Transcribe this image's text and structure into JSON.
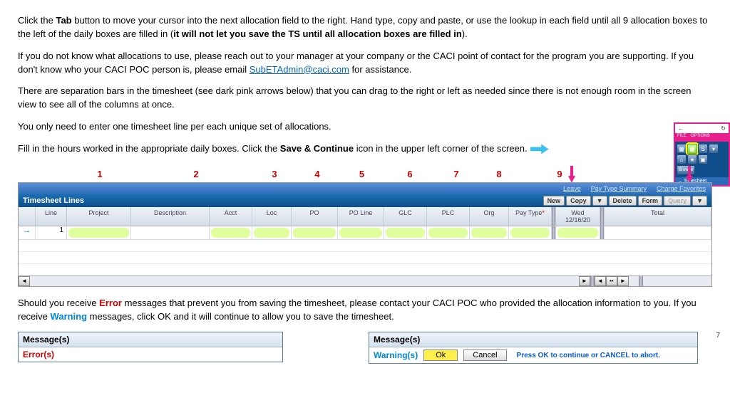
{
  "para1a": "Click the ",
  "para1b": "Tab",
  "para1c": " button to move your cursor into the next allocation field to the right.  Hand type, copy and paste, or use the lookup in each field until all 9 allocation boxes to the left of the daily boxes are filled in (",
  "para1d": "it will not let you save the TS until all allocation boxes are filled in",
  "para1e": ").",
  "para2a": "If you do not know what allocations to use, please reach out to your manager at your company or the CACI point of contact for the program you are supporting.  If you don't know who your CACI POC person is, please email ",
  "para2link": "SubETAdmin@caci.com",
  "para2b": " for assistance.",
  "para3": "There are separation bars in the timesheet (see dark pink arrows below) that you can drag to the right or left as needed since there is not enough room in the screen view to see all of the columns at once.",
  "para4": "You only need to enter one timesheet line per each unique set of allocations.",
  "para5a": "Fill in the hours worked in the appropriate daily boxes. Click the ",
  "para5b": "Save & Continue",
  "para5c": " icon in the upper left corner of the screen.",
  "nums": [
    "1",
    "2",
    "3",
    "4",
    "5",
    "6",
    "7",
    "8",
    "9"
  ],
  "top": {
    "leave": "Leave",
    "pts": "Pay Type Summary",
    "cf": "Charge Favorites"
  },
  "title": "Timesheet Lines",
  "btns": {
    "new": "New",
    "copy": "Copy",
    "del": "Delete",
    "form": "Form",
    "query": "Query"
  },
  "hdr": {
    "line": "Line",
    "project": "Project",
    "desc": "Description",
    "acct": "Acct",
    "loc": "Loc",
    "po": "PO",
    "poline": "PO Line",
    "glc": "GLC",
    "plc": "PLC",
    "org": "Org",
    "pay": "Pay Type",
    "star": "*",
    "wed": "Wed",
    "date": "12/16/20",
    "total": "Total"
  },
  "row1": "1",
  "arrow": "→",
  "after1": "Should you receive ",
  "err": "Error",
  "after2": " messages that prevent you from saving the timesheet, please contact your CACI POC who provided the allocation information to you.  If you receive ",
  "warn": "Warning",
  "after3": " messages, click OK and it will continue to allow you to save the timesheet.",
  "msg": {
    "h": "Message(s)",
    "errs": "Error(s)",
    "warns": "Warning(s)",
    "ok": "Ok",
    "cancel": "Cancel",
    "hint": "Press OK to continue or CANCEL to abort."
  },
  "inset": {
    "file": "FILE",
    "opts": "OPTIONS",
    "browse": "Browse",
    "ts": "→ Timesheet",
    "back": "←",
    "refresh": "↻"
  },
  "page": "7"
}
